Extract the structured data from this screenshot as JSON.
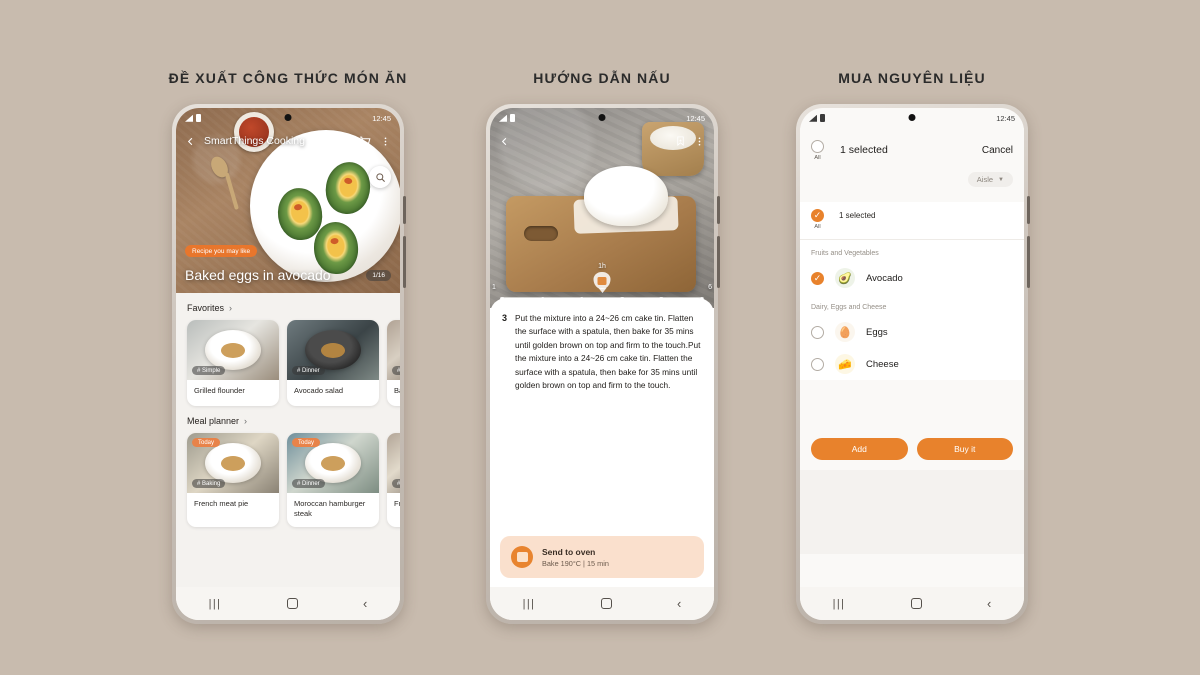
{
  "page": {
    "background_color": "#c8bbae",
    "accent_color": "#e8822c"
  },
  "panels": [
    {
      "title": "ĐỀ XUẤT CÔNG THỨC MÓN ĂN"
    },
    {
      "title": "HƯỚNG DẪN NẤU"
    },
    {
      "title": "MUA NGUYÊN LIỆU"
    }
  ],
  "status_bar": {
    "time": "12:45"
  },
  "nav_bar": {
    "recents": "|||",
    "home": "home-square",
    "back": "‹"
  },
  "phone1": {
    "app_title": "SmartThings Cooking",
    "icons": {
      "back": "back-arrow-icon",
      "cart": "cart-icon",
      "more": "more-vertical-icon",
      "search": "search-icon"
    },
    "hero": {
      "badge": "Recipe you may like",
      "name": "Baked eggs in avocado",
      "counter": "1/16"
    },
    "sections": [
      {
        "heading": "Favorites",
        "chevron": "›",
        "cards": [
          {
            "tag": "# Simple",
            "label": "Grilled flounder",
            "today": ""
          },
          {
            "tag": "# Dinner",
            "label": "Avocado salad",
            "today": ""
          },
          {
            "tag": "# B",
            "label": "Bac",
            "today": ""
          }
        ]
      },
      {
        "heading": "Meal planner",
        "chevron": "›",
        "cards": [
          {
            "tag": "# Baking",
            "label": "French meat pie",
            "today": "Today"
          },
          {
            "tag": "# Dinner",
            "label": "Moroccan hamburger steak",
            "today": "Today"
          },
          {
            "tag": "# B",
            "label": "Fren",
            "today": ""
          }
        ]
      }
    ]
  },
  "phone2": {
    "icons": {
      "back": "back-arrow-icon",
      "bookmark": "bookmark-icon",
      "more": "more-vertical-icon",
      "oven": "oven-icon"
    },
    "timeline": {
      "duration_label": "1h",
      "start": "1",
      "end": "6",
      "steps": 6
    },
    "step": {
      "number": "3",
      "text": "Put the mixture into a 24~26 cm cake tin. Flatten the surface with a spatula, then bake for 35 mins until golden brown on top and firm to the touch.Put the mixture into a 24~26 cm cake tin. Flatten the surface with a spatula, then bake for 35 mins until golden brown on top and firm to the touch."
    },
    "cta": {
      "title": "Send to oven",
      "subtitle": "Bake 190°C   |   15 min"
    }
  },
  "phone3": {
    "header": {
      "all_label": "All",
      "selected": "1 selected",
      "cancel": "Cancel"
    },
    "sort": {
      "label": "Aisle",
      "chevron": "▼"
    },
    "select_all_row": {
      "all_label": "All",
      "text": "1 selected"
    },
    "groups": [
      {
        "title": "Fruits and Vegetables",
        "items": [
          {
            "name": "Avocado",
            "icon": "avocado-icon",
            "checked": true
          }
        ]
      },
      {
        "title": "Dairy, Eggs and Cheese",
        "items": [
          {
            "name": "Eggs",
            "icon": "eggs-icon",
            "checked": false
          },
          {
            "name": "Cheese",
            "icon": "cheese-icon",
            "checked": false
          }
        ]
      }
    ],
    "buttons": {
      "add": "Add",
      "buy": "Buy it"
    }
  }
}
